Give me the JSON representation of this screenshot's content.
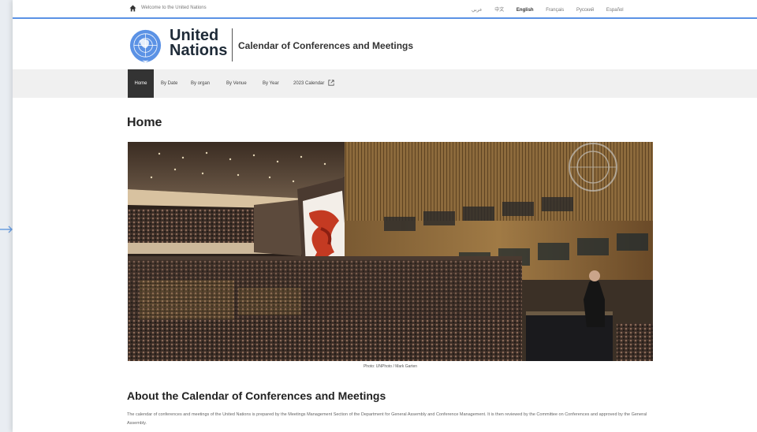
{
  "topbar": {
    "welcome": "Welcome to the United Nations",
    "languages": [
      "عربي",
      "中文",
      "English",
      "Français",
      "Русский",
      "Español"
    ],
    "active_language": "English"
  },
  "header": {
    "logo_line1": "United",
    "logo_line2": "Nations",
    "site_title": "Calendar of Conferences and Meetings"
  },
  "nav": {
    "items": [
      "Home",
      "By Date",
      "By organ",
      "By Venue",
      "By Year",
      "2023 Calendar"
    ]
  },
  "main": {
    "title": "Home",
    "photo_credit": "Photo: UNPhoto / Mark Garten",
    "section_title": "About the Calendar of Conferences and Meetings",
    "body_text": "The calendar of conferences and meetings of the United Nations is prepared by the Meetings Management Section of the Department for General Assembly and Conference Management. It is then reviewed by the Committee on Conferences and approved by the General Assembly."
  },
  "colors": {
    "accent": "#5b92e5",
    "nav_active": "#333333",
    "nav_bg": "#f0f0f0"
  }
}
